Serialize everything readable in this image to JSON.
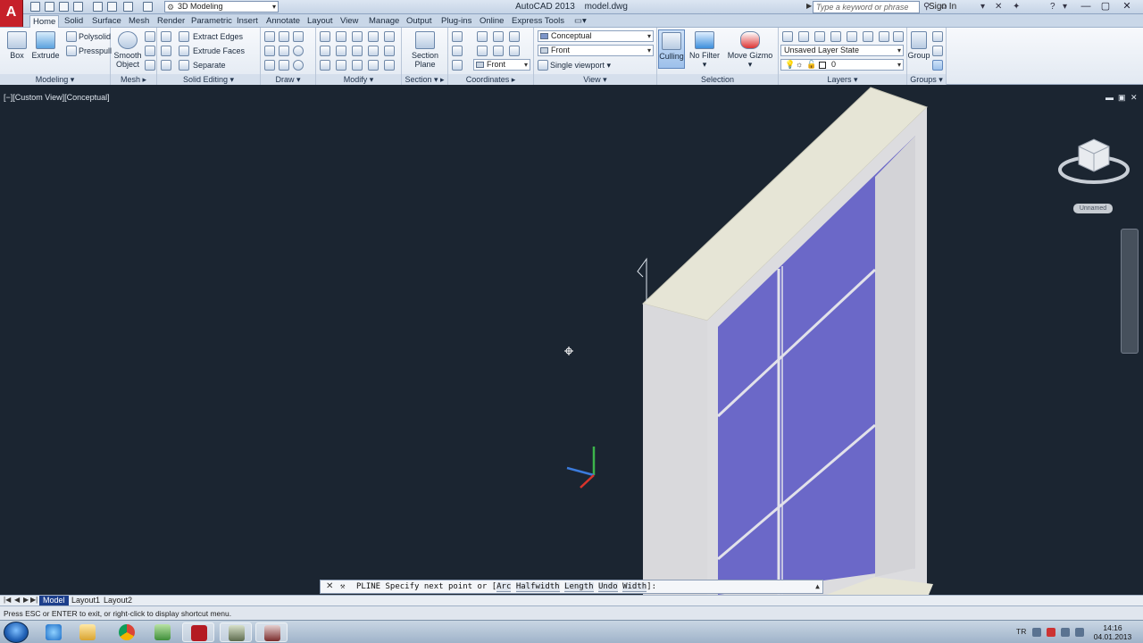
{
  "title_bar": {
    "app_title": "AutoCAD 2013",
    "file_name": "model.dwg",
    "workspace": "3D Modeling",
    "search_placeholder": "Type a keyword or phrase",
    "sign_in": "Sign In"
  },
  "tabs": [
    "Home",
    "Solid",
    "Surface",
    "Mesh",
    "Render",
    "Parametric",
    "Insert",
    "Annotate",
    "Layout",
    "View",
    "Manage",
    "Output",
    "Plug-ins",
    "Online",
    "Express Tools"
  ],
  "active_tab": "Home",
  "ribbon": {
    "modeling": {
      "title": "Modeling",
      "box": "Box",
      "extrude": "Extrude",
      "polysolid": "Polysolid",
      "presspull": "Presspull"
    },
    "mesh": {
      "title": "Mesh",
      "smooth_object_1": "Smooth",
      "smooth_object_2": "Object"
    },
    "solid_editing": {
      "title": "Solid Editing",
      "extract_edges": "Extract Edges",
      "extrude_faces": "Extrude Faces",
      "separate": "Separate"
    },
    "draw": {
      "title": "Draw"
    },
    "modify": {
      "title": "Modify"
    },
    "section": {
      "title": "Section",
      "section_plane_1": "Section",
      "section_plane_2": "Plane"
    },
    "coordinates": {
      "title": "Coordinates",
      "ucs_view": "Front"
    },
    "view": {
      "title": "View",
      "visual_style": "Conceptual",
      "named_view": "Front",
      "viewport_config": "Single viewport"
    },
    "selection": {
      "title": "Selection",
      "culling": "Culling",
      "no_filter": "No Filter",
      "move_gizmo": "Move Gizmo"
    },
    "layers": {
      "title": "Layers",
      "layer_state": "Unsaved Layer State",
      "current_layer": "0"
    },
    "groups": {
      "title": "Groups",
      "group": "Group"
    }
  },
  "viewport": {
    "label": "[−][Custom View][Conceptual]",
    "wcs": "Unnamed",
    "colors": {
      "background": "#1b2531",
      "frame_light": "#e9e8d8",
      "frame_side": "#d9d9d9",
      "glass": "#6a66c6"
    }
  },
  "command_line": {
    "prefix": "PLINE Specify next point or [",
    "options": [
      "Arc",
      "Halfwidth",
      "Length",
      "Undo",
      "Width"
    ],
    "suffix": "]:"
  },
  "layout_tabs": [
    "Model",
    "Layout1",
    "Layout2"
  ],
  "active_layout": "Model",
  "status_text": "Press ESC or ENTER to exit, or right-click to display shortcut menu.",
  "taskbar": {
    "language": "TR",
    "time": "14:16",
    "date": "04.01.2013",
    "apps": [
      "internet-explorer",
      "file-explorer",
      "chrome",
      "network-app",
      "autocad",
      "autocad-2",
      "autocad-3"
    ]
  }
}
